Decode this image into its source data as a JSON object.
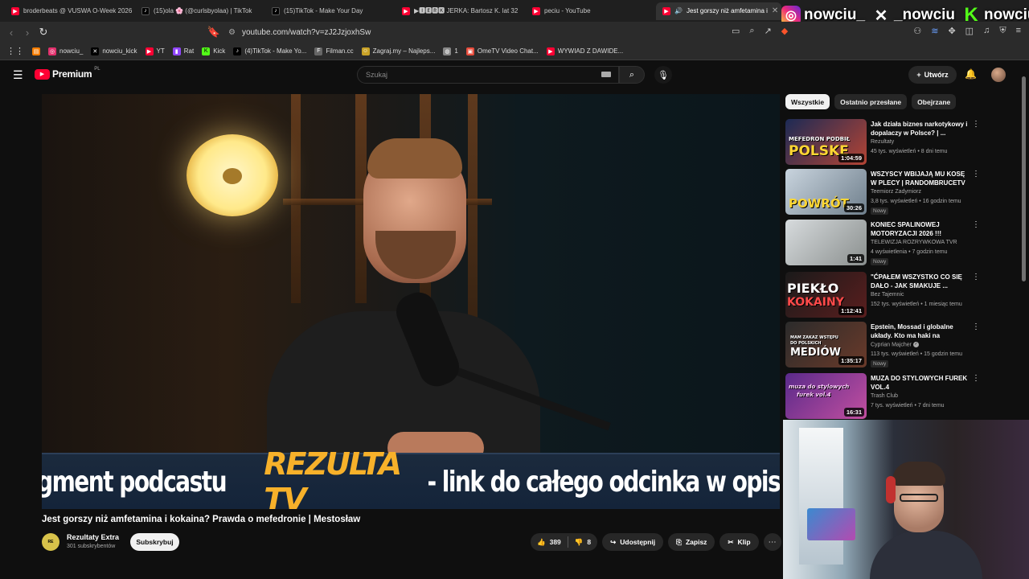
{
  "browser": {
    "tabs": [
      {
        "label": "broderbeats @ VUSWA O-Week 2026",
        "icon": "youtube-icon"
      },
      {
        "label": "(15)ola 🌸 (@curlsbyolaa) | TikTok",
        "icon": "tiktok-icon"
      },
      {
        "label": "(15)TikTok - Make Your Day",
        "icon": "tiktok-icon"
      },
      {
        "label": "▶🅸🅴🆁🅺 JERKA: Bartosz K. lat 32",
        "icon": "youtube-icon"
      },
      {
        "label": "peciu - YouTube",
        "icon": "youtube-icon"
      },
      {
        "label": "Jest gorszy niż amfetamina i",
        "icon": "youtube-icon",
        "active": true
      }
    ],
    "url": "youtube.com/watch?v=zJ2JzjoxhSw",
    "bookmarks": [
      {
        "label": "",
        "icon": "rss-icon",
        "color": "#f57c00"
      },
      {
        "label": "nowciu_",
        "icon": "instagram-icon",
        "color": "#e1306c"
      },
      {
        "label": "nowciu_kick",
        "icon": "x-icon",
        "color": "#000000"
      },
      {
        "label": "YT",
        "icon": "youtube-icon",
        "color": "#ff0033"
      },
      {
        "label": "Rat",
        "icon": "twitch-icon",
        "color": "#9146ff"
      },
      {
        "label": "Kick",
        "icon": "kick-icon",
        "color": "#53fc18"
      },
      {
        "label": "(4)TikTok - Make Yo...",
        "icon": "tiktok-icon",
        "color": "#000000"
      },
      {
        "label": "Filman.cc",
        "icon": "filman-icon",
        "color": "#666666"
      },
      {
        "label": "Zagraj.my – Najleps...",
        "icon": "zagraj-icon",
        "color": "#c9a227"
      },
      {
        "label": "1",
        "icon": "globe-icon",
        "color": "#888888"
      },
      {
        "label": "OmeTV Video Chat...",
        "icon": "ometv-icon",
        "color": "#e74c3c"
      },
      {
        "label": "WYWIAD Z DAWIDE...",
        "icon": "youtube-icon",
        "color": "#ff0033"
      }
    ]
  },
  "overlay": {
    "instagram": "nowciu_",
    "x": "_nowciu",
    "kick": "nowciu"
  },
  "youtube": {
    "logo_text": "Premium",
    "logo_country": "PL",
    "search_placeholder": "Szukaj",
    "create_label": "Utwórz",
    "brand_color": "#ff0033"
  },
  "video": {
    "caption_part1": "Fragment podcastu",
    "caption_brand": "REZULTA TV",
    "caption_part2": "- link do całego odcinka w opisie",
    "title": "Jest gorszy niż amfetamina i kokaina? Prawda o mefedronie | Mestosław",
    "channel": "Rezultaty Extra",
    "subscribers": "301 subskrybentów",
    "subscribe_label": "Subskrybuj",
    "likes": "389",
    "dislikes": "8",
    "share_label": "Udostępnij",
    "save_label": "Zapisz",
    "clip_label": "Klip"
  },
  "sidebar": {
    "chips": [
      "Wszystkie",
      "Ostatnio przesłane",
      "Obejrzane"
    ],
    "recommendations": [
      {
        "title": "Jak działa biznes narkotykowy i dopalaczy w Polsce? | ...",
        "channel": "Rezultaty",
        "meta": "45 tys. wyświetleń • 8 dni temu",
        "duration": "1:04:59",
        "thumb_text": "MEFEDRON PODBIŁ POLSKĘ",
        "badge": "",
        "verified": false
      },
      {
        "title": "WSZYSCY WBIJAJĄ MU KOSĘ W PLECY | RANDOMBRUCETV",
        "channel": "Teemiorz Zadymiorz",
        "meta": "3,8 tys. wyświetleń • 16 godzin temu",
        "duration": "30:26",
        "thumb_text": "POWRÓT",
        "badge": "Nowy",
        "verified": false
      },
      {
        "title": "KONIEC SPALINOWEJ MOTORYZACJI 2026 !!!",
        "channel": "TELEWIZJA ROZRYWKOWA TVR",
        "meta": "4 wyświetlenia • 7 godzin temu",
        "duration": "1:41",
        "thumb_text": "",
        "badge": "Nowy",
        "verified": false
      },
      {
        "title": "\"ĆPAŁEM WSZYSTKO CO SIĘ DAŁO - JAK SMAKUJE ...",
        "channel": "Bez Tajemnic",
        "meta": "152 tys. wyświetleń • 1 miesiąc temu",
        "duration": "1:12:41",
        "thumb_text": "PIEKŁO KOKAINY",
        "badge": "",
        "verified": false
      },
      {
        "title": "Epstein, Mossad i globalne układy. Kto ma haki na polskie...",
        "channel": "Cyprian Majcher",
        "meta": "113 tys. wyświetleń • 15 godzin temu",
        "duration": "1:35:17",
        "thumb_text": "MAM ZAKAZ WSTĘPU DO POLSKICH MEDIÓW",
        "badge": "Nowy",
        "verified": true
      },
      {
        "title": "MUZA DO STYLOWYCH FUREK VOL.4",
        "channel": "Trash Club",
        "meta": "7 tys. wyświetleń • 7 dni temu",
        "duration": "16:31",
        "thumb_text": "muza do stylowych furek vol.4",
        "badge": "",
        "verified": false
      }
    ]
  }
}
